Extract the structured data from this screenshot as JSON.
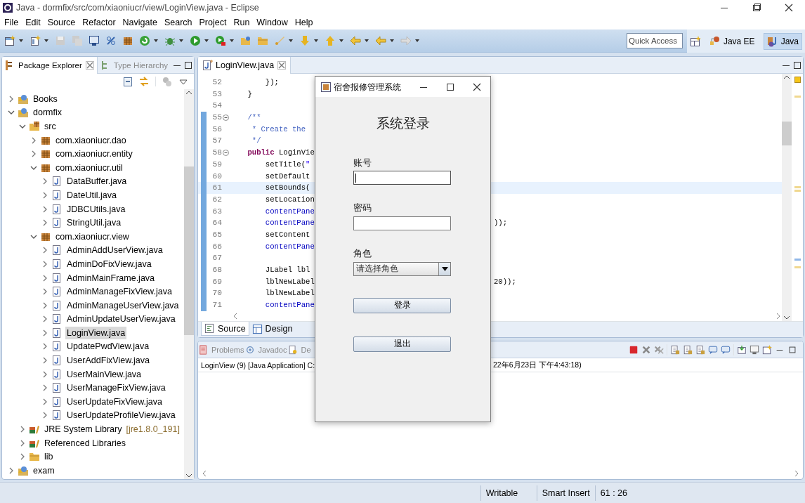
{
  "window": {
    "title": "Java - dormfix/src/com/xiaoniucr/view/LoginView.java - Eclipse"
  },
  "menu": [
    "File",
    "Edit",
    "Source",
    "Refactor",
    "Navigate",
    "Search",
    "Project",
    "Run",
    "Window",
    "Help"
  ],
  "quick_access": {
    "placeholder": "Quick Access"
  },
  "perspectives": [
    {
      "label": "Java EE",
      "selected": false
    },
    {
      "label": "Java",
      "selected": true
    }
  ],
  "package_explorer": {
    "tabs": [
      {
        "label": "Package Explorer",
        "selected": true
      },
      {
        "label": "Type Hierarchy",
        "selected": false
      }
    ],
    "tree": [
      {
        "label": "Books",
        "kind": "project",
        "expanded": false,
        "selected": false
      },
      {
        "label": "dormfix",
        "kind": "project",
        "expanded": true,
        "selected": false,
        "children": [
          {
            "label": "src",
            "kind": "source-folder",
            "expanded": true,
            "selected": false,
            "children": [
              {
                "label": "com.xiaoniucr.dao",
                "kind": "package",
                "expanded": false,
                "selected": false
              },
              {
                "label": "com.xiaoniucr.entity",
                "kind": "package",
                "expanded": false,
                "selected": false
              },
              {
                "label": "com.xiaoniucr.util",
                "kind": "package",
                "expanded": true,
                "selected": false,
                "children": [
                  {
                    "label": "DataBuffer.java",
                    "kind": "java-file",
                    "expanded": false,
                    "selected": false
                  },
                  {
                    "label": "DateUtil.java",
                    "kind": "java-file",
                    "expanded": false,
                    "selected": false
                  },
                  {
                    "label": "JDBCUtils.java",
                    "kind": "java-file",
                    "expanded": false,
                    "selected": false
                  },
                  {
                    "label": "StringUtil.java",
                    "kind": "java-file",
                    "expanded": false,
                    "selected": false
                  }
                ]
              },
              {
                "label": "com.xiaoniucr.view",
                "kind": "package",
                "expanded": true,
                "selected": false,
                "children": [
                  {
                    "label": "AdminAddUserView.java",
                    "kind": "java-file",
                    "expanded": false,
                    "selected": false
                  },
                  {
                    "label": "AdminDoFixView.java",
                    "kind": "java-file",
                    "expanded": false,
                    "selected": false
                  },
                  {
                    "label": "AdminMainFrame.java",
                    "kind": "java-file",
                    "expanded": false,
                    "selected": false
                  },
                  {
                    "label": "AdminManageFixView.java",
                    "kind": "java-file",
                    "expanded": false,
                    "selected": false
                  },
                  {
                    "label": "AdminManageUserView.java",
                    "kind": "java-file",
                    "expanded": false,
                    "selected": false
                  },
                  {
                    "label": "AdminUpdateUserView.java",
                    "kind": "java-file",
                    "expanded": false,
                    "selected": false
                  },
                  {
                    "label": "LoginView.java",
                    "kind": "java-file",
                    "expanded": false,
                    "selected": true
                  },
                  {
                    "label": "UpdatePwdView.java",
                    "kind": "java-file",
                    "expanded": false,
                    "selected": false
                  },
                  {
                    "label": "UserAddFixView.java",
                    "kind": "java-file",
                    "expanded": false,
                    "selected": false
                  },
                  {
                    "label": "UserMainView.java",
                    "kind": "java-file",
                    "expanded": false,
                    "selected": false
                  },
                  {
                    "label": "UserManageFixView.java",
                    "kind": "java-file",
                    "expanded": false,
                    "selected": false
                  },
                  {
                    "label": "UserUpdateFixView.java",
                    "kind": "java-file",
                    "expanded": false,
                    "selected": false
                  },
                  {
                    "label": "UserUpdateProfileView.java",
                    "kind": "java-file",
                    "expanded": false,
                    "selected": false
                  }
                ]
              }
            ]
          },
          {
            "label": "JRE System Library",
            "decoration": "[jre1.8.0_191]",
            "kind": "library",
            "expanded": false,
            "selected": false
          },
          {
            "label": "Referenced Libraries",
            "kind": "library",
            "expanded": false,
            "selected": false
          },
          {
            "label": "lib",
            "kind": "folder",
            "expanded": false,
            "selected": false
          }
        ]
      },
      {
        "label": "exam",
        "kind": "project",
        "expanded": false,
        "selected": false
      }
    ]
  },
  "editor": {
    "tabs": [
      {
        "label": "LoginView.java",
        "selected": true
      }
    ],
    "lines": [
      {
        "number": "52",
        "current": false,
        "changed": false,
        "foldable": false,
        "tokens": [
          {
            "text": "        });",
            "kind": "plain"
          }
        ]
      },
      {
        "number": "53",
        "current": false,
        "changed": false,
        "foldable": false,
        "tokens": [
          {
            "text": "    }",
            "kind": "plain"
          }
        ]
      },
      {
        "number": "54",
        "current": false,
        "changed": false,
        "foldable": false
      },
      {
        "number": "55",
        "current": false,
        "changed": true,
        "foldable": true,
        "tokens": [
          {
            "text": "    /**",
            "kind": "comment"
          }
        ]
      },
      {
        "number": "56",
        "current": false,
        "changed": true,
        "foldable": false,
        "tokens": [
          {
            "text": "     * Create the",
            "kind": "comment"
          }
        ]
      },
      {
        "number": "57",
        "current": false,
        "changed": true,
        "foldable": false,
        "tokens": [
          {
            "text": "     */",
            "kind": "comment"
          }
        ]
      },
      {
        "number": "58",
        "current": false,
        "changed": true,
        "foldable": true,
        "tokens": [
          {
            "text": "    public",
            "kind": "keyword"
          },
          {
            "text": " LoginVie",
            "kind": "plain"
          }
        ]
      },
      {
        "number": "59",
        "current": false,
        "changed": true,
        "foldable": false,
        "tokens": [
          {
            "text": "        setTitle(",
            "kind": "plain"
          },
          {
            "text": "\"",
            "kind": "string"
          }
        ]
      },
      {
        "number": "60",
        "current": false,
        "changed": true,
        "foldable": false,
        "tokens": [
          {
            "text": "        setDefault",
            "kind": "plain"
          }
        ]
      },
      {
        "number": "61",
        "current": true,
        "changed": true,
        "foldable": false,
        "tokens": [
          {
            "text": "        setBounds(",
            "kind": "plain"
          }
        ]
      },
      {
        "number": "62",
        "current": false,
        "changed": true,
        "foldable": false,
        "tokens": [
          {
            "text": "        setLocation",
            "kind": "plain"
          }
        ]
      },
      {
        "number": "63",
        "current": false,
        "changed": true,
        "foldable": false,
        "tokens": [
          {
            "text": "        contentPane",
            "kind": "field"
          }
        ]
      },
      {
        "number": "64",
        "current": false,
        "changed": true,
        "foldable": false,
        "tokens": [
          {
            "text": "        contentPane",
            "kind": "field"
          }
        ],
        "tail": "));"
      },
      {
        "number": "65",
        "current": false,
        "changed": true,
        "foldable": false,
        "tokens": [
          {
            "text": "        setContent",
            "kind": "plain"
          }
        ]
      },
      {
        "number": "66",
        "current": false,
        "changed": true,
        "foldable": false,
        "tokens": [
          {
            "text": "        contentPane",
            "kind": "field"
          }
        ]
      },
      {
        "number": "67",
        "current": false,
        "changed": true,
        "foldable": false
      },
      {
        "number": "68",
        "current": false,
        "changed": true,
        "foldable": false,
        "tokens": [
          {
            "text": "        JLabel lbl",
            "kind": "plain"
          }
        ]
      },
      {
        "number": "69",
        "current": false,
        "changed": true,
        "foldable": false,
        "tokens": [
          {
            "text": "        lblNewLabel",
            "kind": "plain"
          }
        ],
        "tail": "20));"
      },
      {
        "number": "70",
        "current": false,
        "changed": true,
        "foldable": false,
        "tokens": [
          {
            "text": "        lblNewLabel",
            "kind": "plain"
          }
        ]
      },
      {
        "number": "71",
        "current": false,
        "changed": true,
        "foldable": false,
        "tokens": [
          {
            "text": "        contentPane",
            "kind": "field"
          }
        ]
      }
    ],
    "bottom_tabs": [
      {
        "label": "Source",
        "selected": true
      },
      {
        "label": "Design",
        "selected": false
      }
    ]
  },
  "console": {
    "tabs": [
      {
        "label": "Problems",
        "selected": false
      },
      {
        "label": "Javadoc",
        "selected": false
      },
      {
        "label": "De",
        "selected": false
      }
    ],
    "launch": "LoginView (9) [Java Application] C:",
    "launch_tail": "22年6月23日 下午4:43:18)"
  },
  "status_bar": [
    "Writable",
    "Smart Insert",
    "61 : 26"
  ],
  "dialog": {
    "title": "宿舍报修管理系统",
    "heading": "系统登录",
    "fields": [
      {
        "label": "账号",
        "kind": "text",
        "focused": true
      },
      {
        "label": "密码",
        "kind": "password",
        "focused": false
      },
      {
        "label": "角色",
        "kind": "select",
        "value": "请选择角色",
        "focused": false
      }
    ],
    "buttons": [
      "登录",
      "退出"
    ]
  }
}
